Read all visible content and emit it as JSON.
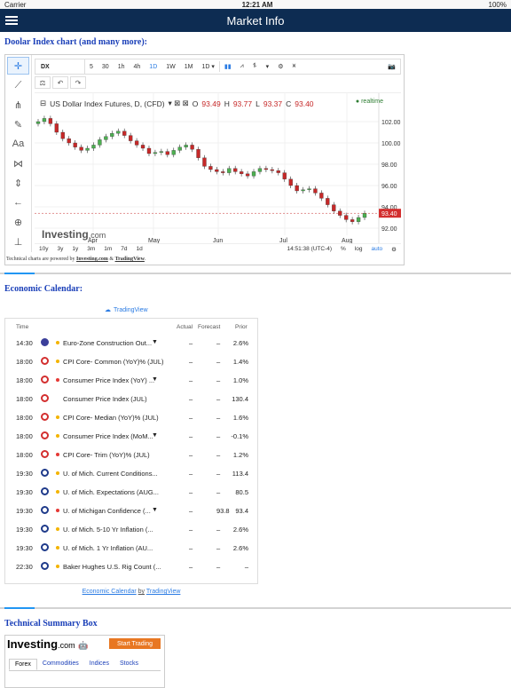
{
  "status_bar": {
    "carrier": "Carrier",
    "time": "12:21 AM",
    "battery": "100%"
  },
  "nav": {
    "title": "Market Info"
  },
  "sections": {
    "chart_title": "Doolar Index chart (and many more):",
    "calendar_title": "Economic Calendar:",
    "summary_title": "Technical Summary Box"
  },
  "chart_widget": {
    "symbol": "DX",
    "intervals": [
      "5",
      "30",
      "1h",
      "4h",
      "1D",
      "1W",
      "1M"
    ],
    "active_interval": "1D",
    "interval_select": "1D",
    "series_title": "US Dollar Index Futures, D, (CFD)",
    "ohlc": {
      "o_label": "O",
      "o": "93.49",
      "h_label": "H",
      "h": "93.77",
      "l_label": "L",
      "l": "93.37",
      "c_label": "C",
      "c": "93.40"
    },
    "realtime_label": "realtime",
    "last_price_label": "93.40",
    "watermark_brand": "Investing",
    "watermark_suffix": ".com",
    "ranges": [
      "10y",
      "3y",
      "1y",
      "3m",
      "1m",
      "7d",
      "1d"
    ],
    "clock": "14:51:38 (UTC-4)",
    "bottom_right": [
      "%",
      "log",
      "auto"
    ],
    "powered_prefix": "Technical charts are powered by",
    "powered_link1": "Investing.com",
    "powered_amp": "&",
    "powered_link2": "TradingView",
    "colors": {
      "up": "#26a69a",
      "down": "#c62828",
      "up_fill": "#4caf50"
    }
  },
  "chart_data": {
    "type": "candlestick",
    "title": "US Dollar Index Futures, D, (CFD)",
    "x_tick_labels": [
      "Apr",
      "May",
      "Jun",
      "Jul",
      "Aug"
    ],
    "y_tick_labels": [
      "102.00",
      "100.00",
      "98.00",
      "96.00",
      "94.00",
      "92.00"
    ],
    "ylim": [
      91.5,
      103.0
    ],
    "grid": true,
    "closes": [
      102.0,
      102.3,
      101.8,
      101.0,
      100.4,
      100.0,
      99.6,
      99.3,
      99.5,
      99.8,
      100.3,
      100.6,
      100.9,
      101.1,
      100.7,
      100.2,
      99.8,
      99.5,
      99.0,
      99.1,
      99.2,
      98.9,
      99.3,
      99.6,
      99.8,
      99.4,
      98.6,
      97.8,
      97.5,
      97.3,
      97.2,
      97.6,
      97.3,
      97.1,
      96.9,
      97.3,
      97.6,
      97.5,
      97.4,
      97.2,
      96.6,
      96.0,
      95.5,
      95.6,
      95.7,
      95.3,
      94.8,
      94.2,
      93.6,
      93.2,
      92.8,
      92.6,
      93.0,
      93.4
    ],
    "last_close": 93.4,
    "ohlc_last": {
      "open": 93.49,
      "high": 93.77,
      "low": 93.37,
      "close": 93.4
    }
  },
  "calendar": {
    "provider": "TradingView",
    "headers": {
      "time": "Time",
      "actual": "Actual",
      "forecast": "Forecast",
      "prior": "Prior"
    },
    "rows": [
      {
        "time": "14:30",
        "country": "eu",
        "importance": "medium",
        "event": "Euro-Zone Construction Out...",
        "dropdown": true,
        "actual": "–",
        "forecast": "–",
        "prior": "2.6%"
      },
      {
        "time": "18:00",
        "country": "ca",
        "importance": "medium",
        "event": "CPI Core- Common (YoY)% (JUL)",
        "dropdown": false,
        "actual": "–",
        "forecast": "–",
        "prior": "1.4%"
      },
      {
        "time": "18:00",
        "country": "ca",
        "importance": "high",
        "event": "Consumer Price Index (YoY) ...",
        "dropdown": true,
        "actual": "–",
        "forecast": "–",
        "prior": "1.0%"
      },
      {
        "time": "18:00",
        "country": "ca",
        "importance": "none",
        "event": "Consumer Price Index (JUL)",
        "dropdown": false,
        "actual": "–",
        "forecast": "–",
        "prior": "130.4"
      },
      {
        "time": "18:00",
        "country": "ca",
        "importance": "medium",
        "event": "CPI Core- Median (YoY)% (JUL)",
        "dropdown": false,
        "actual": "–",
        "forecast": "–",
        "prior": "1.6%"
      },
      {
        "time": "18:00",
        "country": "ca",
        "importance": "medium",
        "event": "Consumer Price Index (MoM...",
        "dropdown": true,
        "actual": "–",
        "forecast": "–",
        "prior": "-0.1%"
      },
      {
        "time": "18:00",
        "country": "ca",
        "importance": "high",
        "event": "CPI Core- Trim (YoY)% (JUL)",
        "dropdown": false,
        "actual": "–",
        "forecast": "–",
        "prior": "1.2%"
      },
      {
        "time": "19:30",
        "country": "us",
        "importance": "medium",
        "event": "U. of Mich. Current Conditions...",
        "dropdown": false,
        "actual": "–",
        "forecast": "–",
        "prior": "113.4"
      },
      {
        "time": "19:30",
        "country": "us",
        "importance": "medium",
        "event": "U. of Mich. Expectations (AUG...",
        "dropdown": false,
        "actual": "–",
        "forecast": "–",
        "prior": "80.5"
      },
      {
        "time": "19:30",
        "country": "us",
        "importance": "high",
        "event": "U. of Michigan Confidence (...",
        "dropdown": true,
        "actual": "–",
        "forecast": "93.8",
        "prior": "93.4"
      },
      {
        "time": "19:30",
        "country": "us",
        "importance": "medium",
        "event": "U. of Mich. 5-10 Yr Inflation (...",
        "dropdown": false,
        "actual": "–",
        "forecast": "–",
        "prior": "2.6%"
      },
      {
        "time": "19:30",
        "country": "us",
        "importance": "medium",
        "event": "U. of Mich. 1 Yr Inflation (AU...",
        "dropdown": false,
        "actual": "–",
        "forecast": "–",
        "prior": "2.6%"
      },
      {
        "time": "22:30",
        "country": "us",
        "importance": "medium",
        "event": "Baker Hughes U.S. Rig Count (...",
        "dropdown": false,
        "actual": "–",
        "forecast": "–",
        "prior": "–"
      }
    ],
    "footer_link": "Economic Calendar",
    "footer_by": "by",
    "footer_provider": "TradingView",
    "importance_colors": {
      "high": "#e53935",
      "medium": "#f4b400",
      "none": "#ffffff"
    }
  },
  "summary_box": {
    "brand": "Investing",
    "brand_suffix": ".com",
    "cta": "Start Trading",
    "tabs": [
      "Forex",
      "Commodities",
      "Indices",
      "Stocks"
    ],
    "active_tab": "Forex"
  }
}
